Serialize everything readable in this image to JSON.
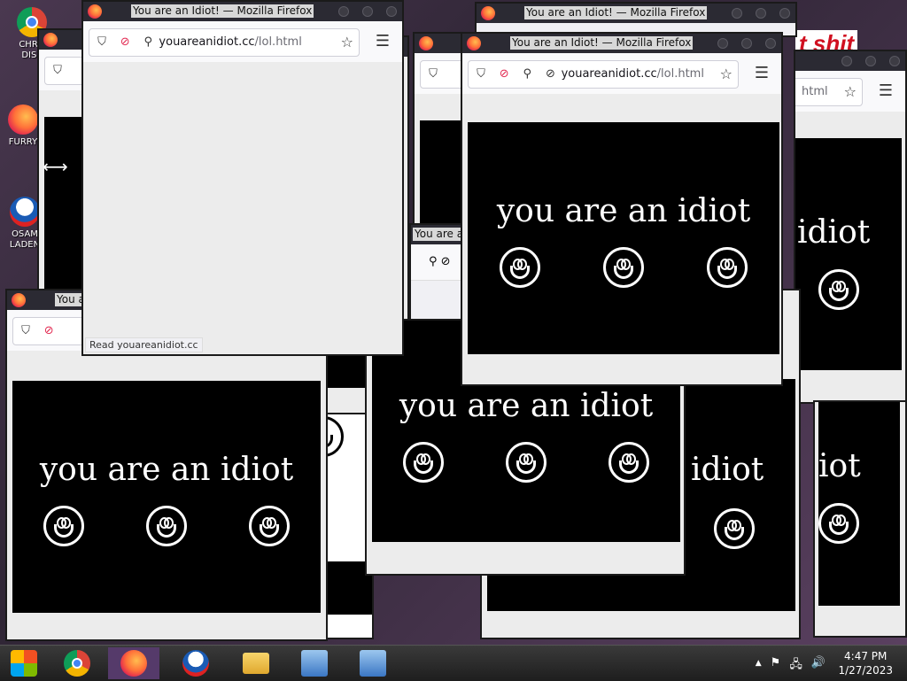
{
  "colors": {
    "titlebar": "#2b2a33",
    "stage_bg": "#000000",
    "page_bg": "#ececec",
    "taskbar_active": "#553a6a"
  },
  "desktop": {
    "icons": [
      {
        "label": "CHRO DISE",
        "icon": "chrome-icon"
      },
      {
        "label": "FURRY",
        "icon": "firefox-icon"
      },
      {
        "label": "OSAM LADEN",
        "icon": "obama-logo-icon"
      }
    ],
    "wallpaper_text": "t shit"
  },
  "window": {
    "title": "You are an Idiot! — Mozilla Firefox",
    "title_short": "You are a",
    "title_shortest": "You a",
    "url_host": "youareanidiot.cc",
    "url_path": "/lol.html",
    "url_partial": "html",
    "message": "you are an idiot",
    "message_partial": "idiot",
    "message_partial2": "iot",
    "status": "Read youareanidiot.cc"
  },
  "taskbar": {
    "items": [
      {
        "icon": "start-orb-icon"
      },
      {
        "icon": "chrome-icon"
      },
      {
        "icon": "firefox-icon"
      },
      {
        "icon": "obama-logo-icon"
      },
      {
        "icon": "file-explorer-icon"
      },
      {
        "icon": "control-panel-icon"
      },
      {
        "icon": "control-panel-icon"
      }
    ],
    "tray": {
      "up_arrow": "▲",
      "flag": "⚑",
      "network": "🖧",
      "volume": "🔊"
    },
    "time": "4:47 PM",
    "date": "1/27/2023"
  }
}
